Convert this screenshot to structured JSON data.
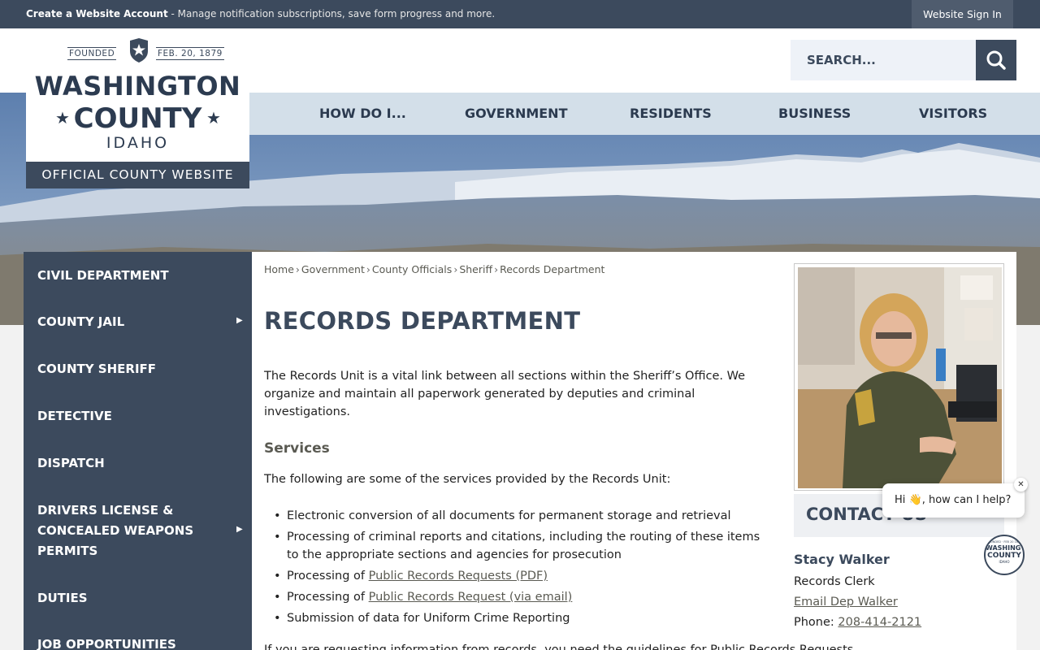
{
  "topbar": {
    "create_label": "Create a Website Account",
    "create_desc": " - Manage notification subscriptions, save form progress and more.",
    "signin_label": "Website Sign In"
  },
  "logo": {
    "founded": "FOUNDED",
    "date": "FEB. 20, 1879",
    "line1": "WASHINGTON",
    "line2": "COUNTY",
    "line3": "IDAHO",
    "tagline": "OFFICIAL COUNTY WEBSITE"
  },
  "search": {
    "placeholder": "SEARCH..."
  },
  "nav": {
    "items": [
      "HOW DO I...",
      "GOVERNMENT",
      "RESIDENTS",
      "BUSINESS",
      "VISITORS"
    ]
  },
  "sidebar": {
    "items": [
      {
        "label": "CIVIL DEPARTMENT",
        "has_submenu": false
      },
      {
        "label": "COUNTY JAIL",
        "has_submenu": true
      },
      {
        "label": "COUNTY SHERIFF",
        "has_submenu": false
      },
      {
        "label": "DETECTIVE",
        "has_submenu": false
      },
      {
        "label": "DISPATCH",
        "has_submenu": false
      },
      {
        "label": "DRIVERS LICENSE & CONCEALED WEAPONS PERMITS",
        "line1": "DRIVERS LICENSE &",
        "line2": "CONCEALED WEAPONS",
        "line3": "PERMITS",
        "has_submenu": true
      },
      {
        "label": "DUTIES",
        "has_submenu": false
      },
      {
        "label": "JOB OPPORTUNITIES",
        "has_submenu": false
      }
    ]
  },
  "breadcrumb": [
    "Home",
    "Government",
    "County Officials",
    "Sheriff",
    "Records Department"
  ],
  "main": {
    "title": "RECORDS DEPARTMENT",
    "intro": "The Records Unit is a vital link between all sections within the Sheriff’s Office. We organize and maintain all paperwork generated by deputies and criminal investigations.",
    "services_heading": "Services",
    "services_intro": "The following are some of the services provided by the Records Unit:",
    "services": [
      {
        "text": "Electronic conversion of all documents for permanent storage and retrieval"
      },
      {
        "text": "Processing of criminal reports and citations, including the routing of these items to the appropriate sections and agencies for prosecution"
      },
      {
        "prefix": "Processing of ",
        "link": "Public Records Requests (PDF)"
      },
      {
        "prefix": "Processing of ",
        "link": "Public Records Request (via email)"
      },
      {
        "text": "Submission of data for Uniform Crime Reporting"
      }
    ],
    "cut_text": "If you are requesting information from records, you need the guidelines for Public Records Requests"
  },
  "contact": {
    "title": "CONTACT US",
    "name": "Stacy Walker",
    "role": "Records Clerk",
    "email_link": "Email Dep Walker",
    "phone_label": "Phone: ",
    "phone": "208-414-2121"
  },
  "chat": {
    "message": "Hi 👋, how can I help?",
    "close": "✕",
    "avatar_small": "FOUNDED · FEB 20 1879",
    "avatar_line1": "WASHINGTON",
    "avatar_line2": "COUNTY",
    "avatar_line3": "IDAHO"
  },
  "colors": {
    "primary": "#3c4a5d",
    "nav_bg": "#d3dfe9",
    "link": "#5a5a52",
    "search_bg": "#eef2f8"
  }
}
